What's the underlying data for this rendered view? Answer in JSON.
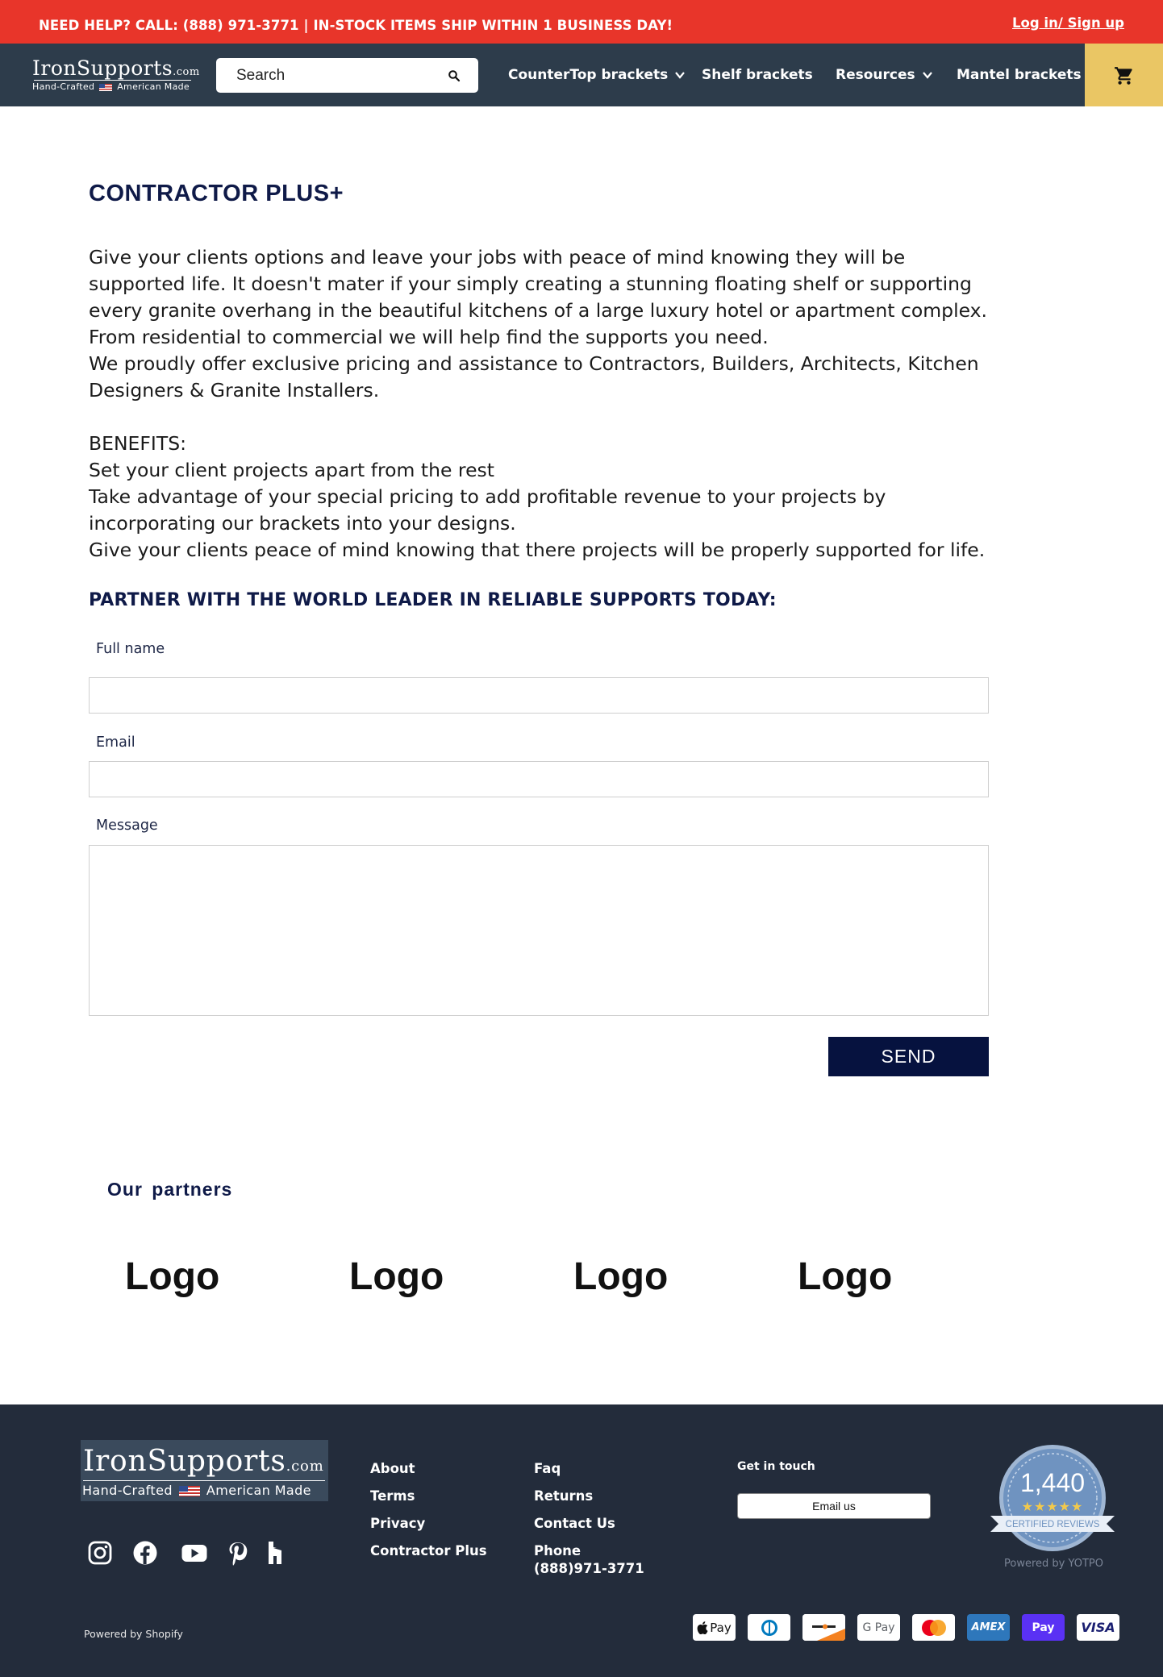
{
  "announcement": {
    "text": "NEED HELP? CALL: (888) 971-3771 | IN-STOCK ITEMS SHIP WITHIN 1 BUSINESS DAY!",
    "login_label": "Log in/ Sign up"
  },
  "header": {
    "logo_main": "IronSupports",
    "logo_domain": ".com",
    "logo_sub_left": "Hand-Crafted",
    "logo_sub_right": "American Made",
    "search_placeholder": "Search",
    "nav": [
      {
        "label": "CounterTop brackets",
        "dropdown": true
      },
      {
        "label": "Shelf brackets",
        "dropdown": false
      },
      {
        "label": "Resources",
        "dropdown": true
      },
      {
        "label": "Mantel brackets",
        "dropdown": false
      }
    ],
    "cart_icon": "cart-icon"
  },
  "main": {
    "title": "CONTRACTOR PLUS+",
    "intro": "Give your clients options and leave your jobs with peace of mind knowing they will be supported life.  It doesn't mater if your simply creating a stunning floating shelf or supporting every granite overhang in the beautiful kitchens of a large luxury hotel or apartment complex. From residential to commercial we will help find the supports you need.\nWe proudly offer exclusive pricing and assistance to Contractors, Builders, Architects, Kitchen Designers & Granite Installers.",
    "benefits_heading": "BENEFITS:",
    "benefits": [
      "Set your client projects apart from the rest",
      "Take advantage of your special pricing to add profitable revenue to your projects by incorporating our brackets into your designs.",
      "Give your clients peace of mind knowing that there projects will be properly supported for life."
    ],
    "cta": "PARTNER WITH THE WORLD LEADER IN RELIABLE SUPPORTS TODAY:",
    "form": {
      "full_name_label": "Full name",
      "full_name_value": "",
      "email_label": "Email",
      "email_value": "",
      "message_label": "Message",
      "message_value": "",
      "send_label": "SEND"
    },
    "partners_title": "Our partners",
    "partner_logos": [
      "Logo",
      "Logo",
      "Logo",
      "Logo"
    ]
  },
  "footer": {
    "logo_main": "IronSupports",
    "logo_domain": ".com",
    "logo_sub_left": "Hand-Crafted",
    "logo_sub_right": "American Made",
    "social_icons": [
      "instagram-icon",
      "facebook-icon",
      "youtube-icon",
      "pinterest-icon",
      "houzz-icon"
    ],
    "col1": [
      "About",
      "Terms",
      "Privacy",
      "Contractor Plus"
    ],
    "col2": [
      "Faq",
      "Returns",
      "Contact Us",
      "Phone"
    ],
    "phone_number": "(888)971-3771",
    "get_in_touch": "Get in touch",
    "email_us_label": "Email us",
    "reviews_count": "1,440",
    "reviews_label": "CERTIFIED REVIEWS",
    "powered_yotpo": "Powered by YOTPO",
    "powered_shopify": "Powered by Shopify",
    "payment_methods": [
      "Apple Pay",
      "Diners Club",
      "Discover",
      "Google Pay",
      "Mastercard",
      "American Express",
      "Shop Pay",
      "Visa"
    ],
    "pay_labels": {
      "apple": "Pay",
      "google": "G Pay",
      "amex": "AMEX",
      "shop": "Pay",
      "visa": "VISA"
    }
  },
  "colors": {
    "announcement_bg": "#e8352a",
    "header_bg": "#2d3c4b",
    "cart_bg": "#eac664",
    "heading_navy": "#0f1a48",
    "send_bg": "#06123f",
    "footer_bg": "#232c3b"
  }
}
